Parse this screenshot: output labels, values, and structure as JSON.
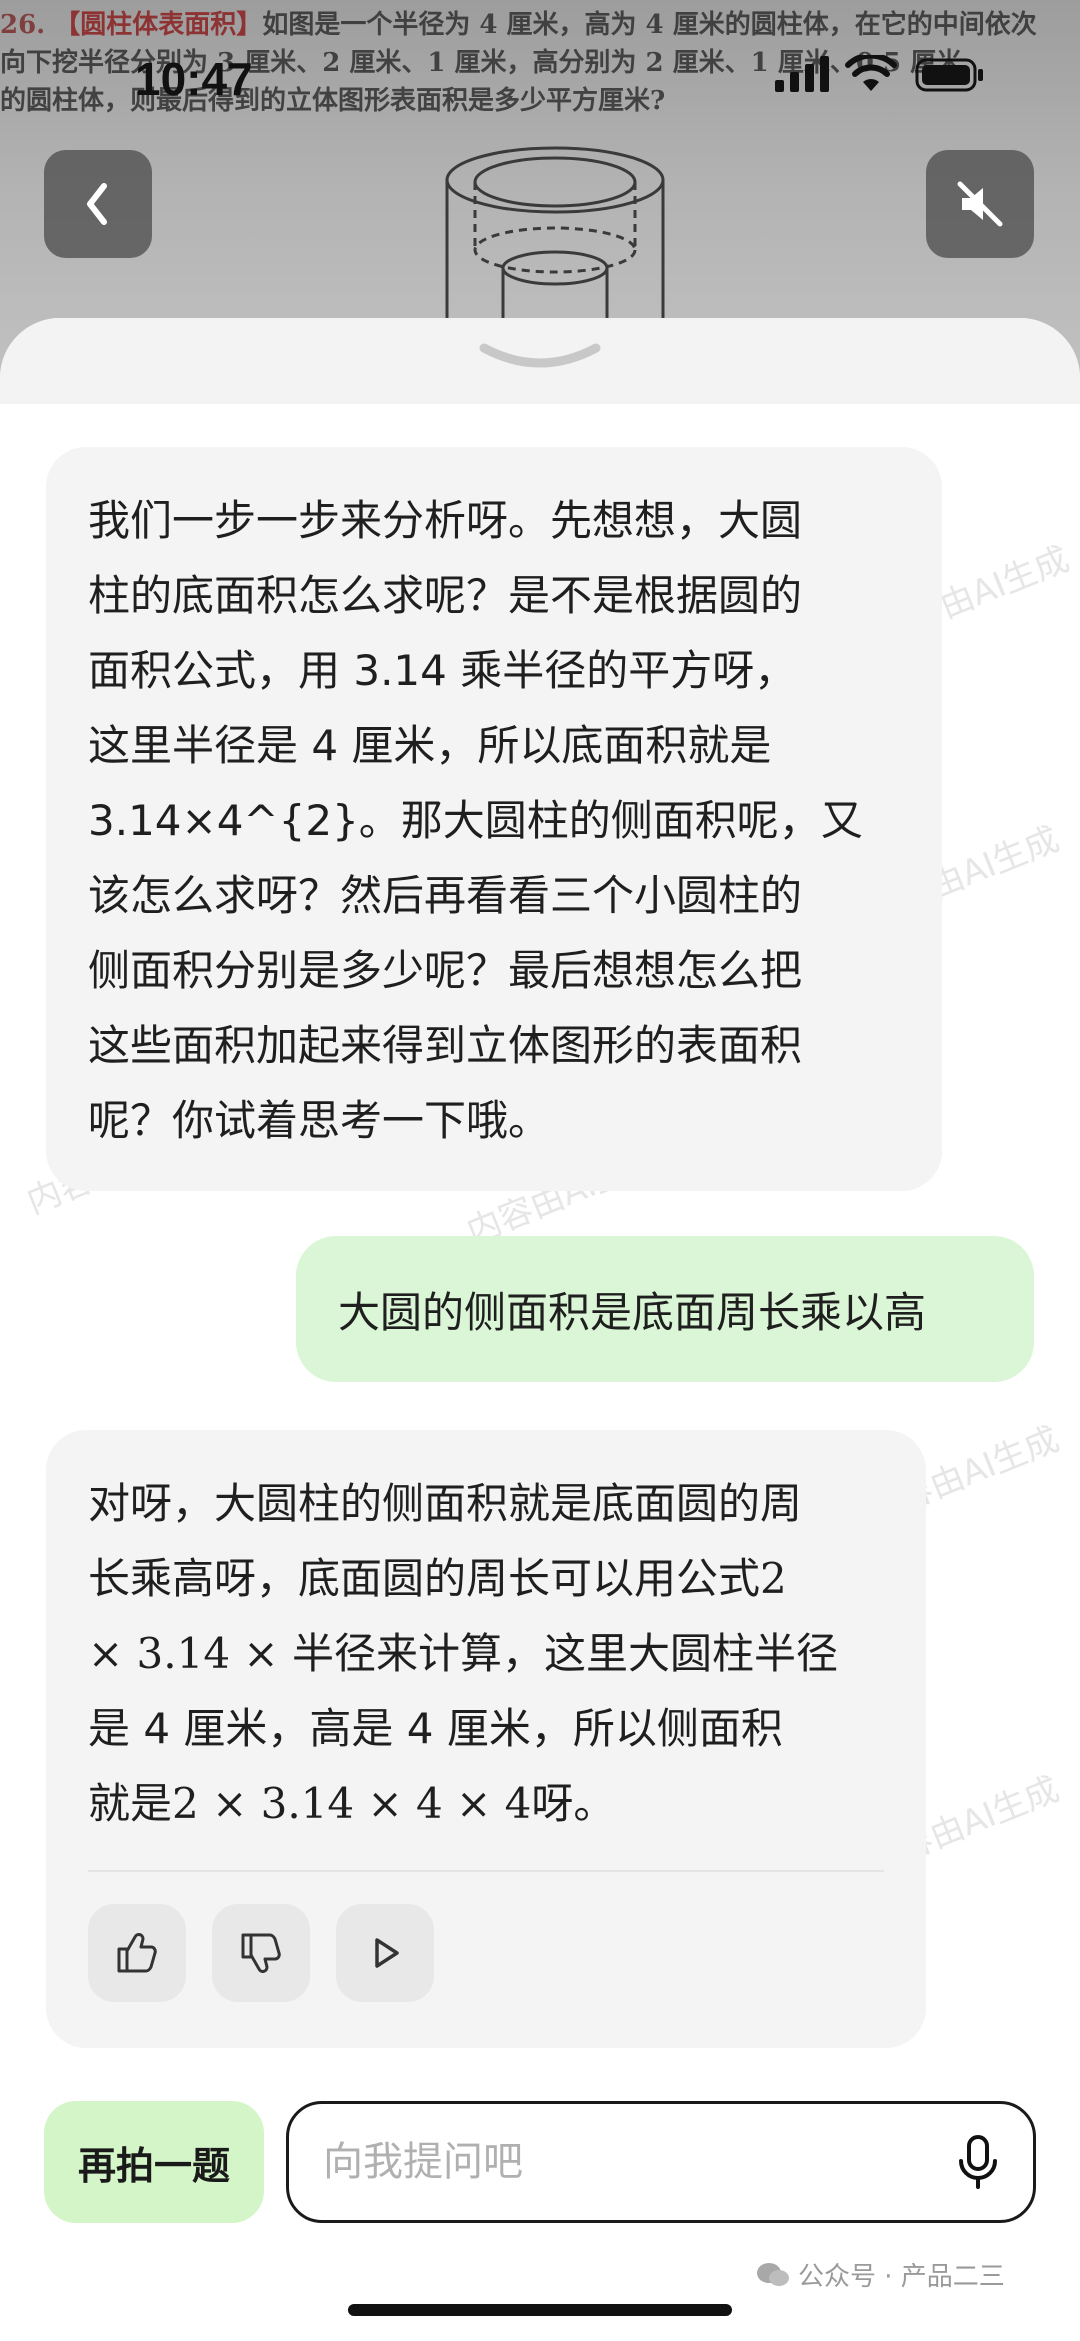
{
  "status_bar": {
    "time": "10:47"
  },
  "photo": {
    "line1_num": "26.",
    "line1_tag": "【圆柱体表面积】",
    "line1_text": "如图是一个半径为 4 厘米，高为 4 厘米的圆柱体，在它的中间依次",
    "line2_text": "向下挖半径分别为 3 厘米、2 厘米、1 厘米，高分别为 2 厘米、1 厘米、0.5 厘米",
    "line3_text": "的圆柱体，则最后得到的立体图形表面积是多少平方厘米?"
  },
  "messages": [
    {
      "role": "assistant",
      "lines": [
        "我们一步一步来分析呀。先想想，大圆",
        "柱的底面积怎么求呢？是不是根据圆的",
        "面积公式，用 3.14 乘半径的平方呀，",
        "这里半径是 4 厘米，所以底面积就是",
        "3.14×4^{2}。那大圆柱的侧面积呢，又",
        "该怎么求呀？然后再看看三个小圆柱的",
        "侧面积分别是多少呢？最后想想怎么把",
        "这些面积加起来得到立体图形的表面积",
        "呢？你试着思考一下哦。"
      ]
    },
    {
      "role": "user",
      "text": "大圆的侧面积是底面周长乘以高"
    },
    {
      "role": "assistant",
      "line1": "对呀，大圆柱的侧面积就是底面圆的周",
      "line2a": "长乘高呀，底面圆的周长可以用公式",
      "line2b": "2",
      "line3a": "× 3.14 ×",
      "line3b": " 半径来计算，这里大圆柱半径",
      "line4": "是 4 厘米，高是 4 厘米，所以侧面积",
      "line5a": "就是",
      "line5b": "2 × 3.14 × 4 × 4",
      "line5c": "呀。"
    }
  ],
  "watermark": "内容由AI生成",
  "input": {
    "retake_label": "再拍一题",
    "placeholder": "向我提问吧"
  },
  "footer": {
    "text": "公众号 · 产品二三"
  },
  "colors": {
    "user_bubble": "#dbf6d6",
    "ai_bubble": "#f4f4f4",
    "retake_button": "#d4f5c8"
  }
}
